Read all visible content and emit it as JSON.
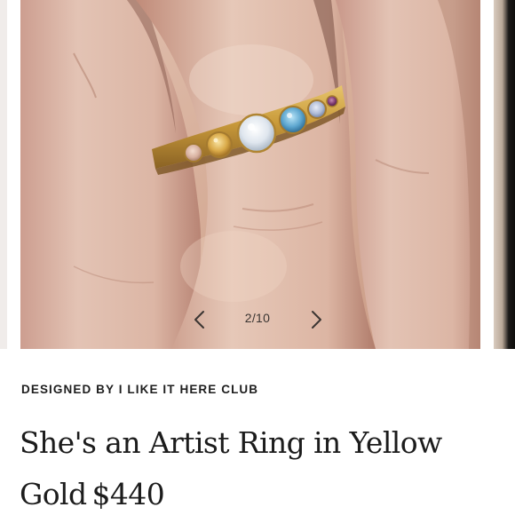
{
  "product": {
    "designer_line": "DESIGNED BY I LIKE IT HERE CLUB",
    "title": "She's an Artist Ring in Yellow Gold",
    "price": "$440"
  },
  "carousel": {
    "counter": "2/10",
    "prev_icon": "chevron-left-icon",
    "next_icon": "chevron-right-icon",
    "image_alt": "ring-photo"
  },
  "colors": {
    "text": "#1c1c1c",
    "skin": "#d9b5a2",
    "gold": "#c49a3e",
    "background": "#ffffff"
  }
}
